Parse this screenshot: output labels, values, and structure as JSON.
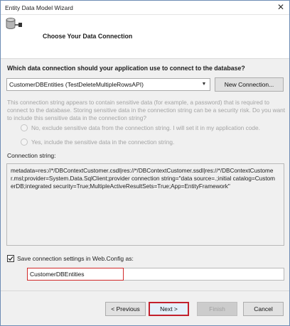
{
  "window": {
    "title": "Entity Data Model Wizard",
    "close_glyph": "✕"
  },
  "header": {
    "page_title": "Choose Your Data Connection",
    "icon": "database-plug-icon"
  },
  "question": "Which data connection should your application use to connect to the database?",
  "connection_select": {
    "value": "CustomerDBEntities (TestDeleteMultipleRowsAPI)",
    "arrow_glyph": "▼"
  },
  "new_connection_button": "New Connection...",
  "sensitive_note": "This connection string appears to contain sensitive data (for example, a password) that is required to connect to the database. Storing sensitive data in the connection string can be a security risk. Do you want to include this sensitive data in the connection string?",
  "radio_options": {
    "exclude": "No, exclude sensitive data from the connection string. I will set it in my application code.",
    "include": "Yes, include the sensitive data in the connection string."
  },
  "connection_string": {
    "label": "Connection string:",
    "value": "metadata=res://*/DBContextCustomer.csdl|res://*/DBContextCustomer.ssdl|res://*/DBContextCustomer.msl;provider=System.Data.SqlClient;provider connection string=\"data source=.;initial catalog=CustomerDB;integrated security=True;MultipleActiveResultSets=True;App=EntityFramework\""
  },
  "save_settings": {
    "checked": true,
    "label": "Save connection settings in Web.Config as:",
    "value": "CustomerDBEntities"
  },
  "buttons": {
    "previous": "< Previous",
    "next": "Next >",
    "finish": "Finish",
    "cancel": "Cancel"
  },
  "colors": {
    "highlight": "#d12a2a",
    "window_border": "#6d8cb4"
  }
}
